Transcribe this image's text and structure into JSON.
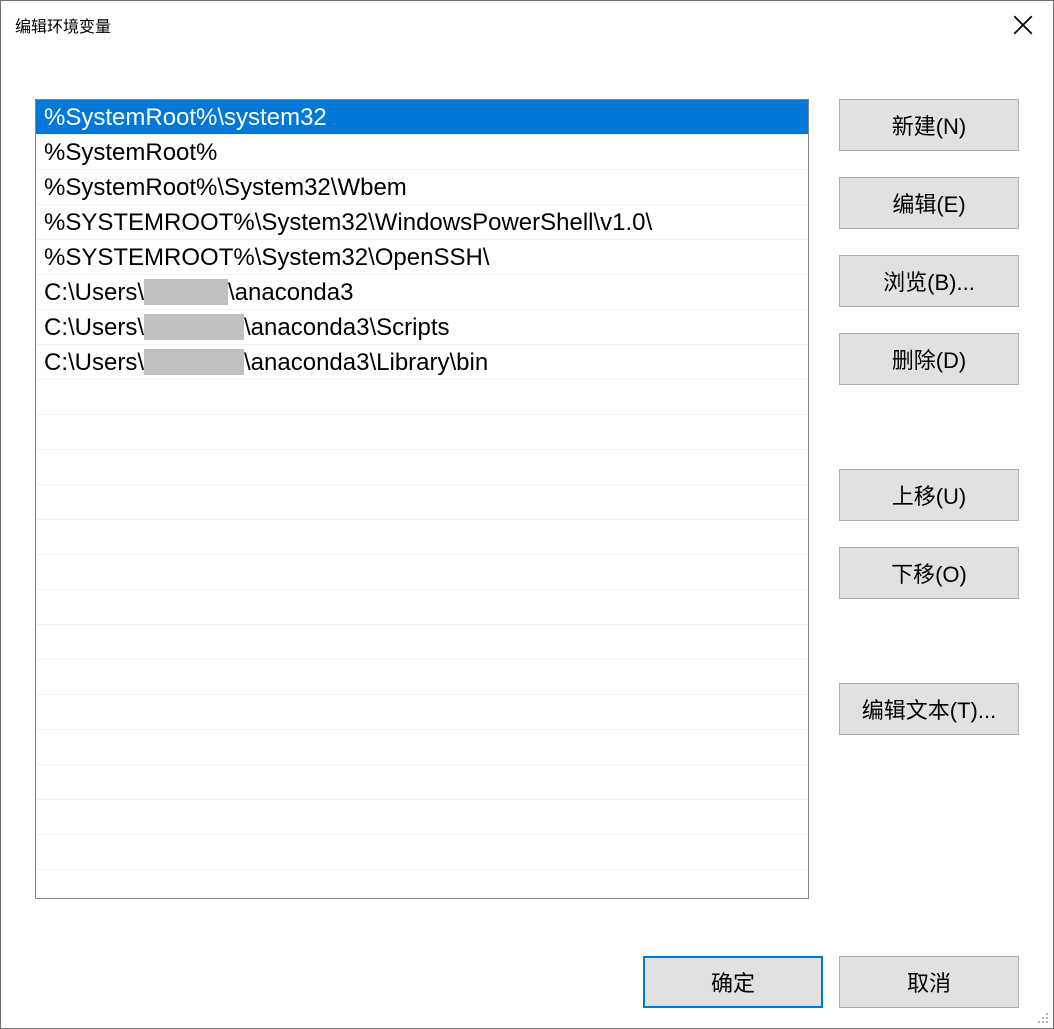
{
  "title": "编辑环境变量",
  "redacted_label": "[redacted]",
  "entries": [
    {
      "prefix": "%SystemRoot%\\system32",
      "redacted_width": 0,
      "suffix": "",
      "selected": true
    },
    {
      "prefix": "%SystemRoot%",
      "redacted_width": 0,
      "suffix": "",
      "selected": false
    },
    {
      "prefix": "%SystemRoot%\\System32\\Wbem",
      "redacted_width": 0,
      "suffix": "",
      "selected": false
    },
    {
      "prefix": "%SYSTEMROOT%\\System32\\WindowsPowerShell\\v1.0\\",
      "redacted_width": 0,
      "suffix": "",
      "selected": false
    },
    {
      "prefix": "%SYSTEMROOT%\\System32\\OpenSSH\\",
      "redacted_width": 0,
      "suffix": "",
      "selected": false
    },
    {
      "prefix": "C:\\Users\\",
      "redacted_width": 84,
      "suffix": "\\anaconda3",
      "selected": false
    },
    {
      "prefix": "C:\\Users\\",
      "redacted_width": 100,
      "suffix": "\\anaconda3\\Scripts",
      "selected": false
    },
    {
      "prefix": "C:\\Users\\",
      "redacted_width": 100,
      "suffix": "\\anaconda3\\Library\\bin",
      "selected": false
    }
  ],
  "buttons": {
    "new": "新建(N)",
    "edit": "编辑(E)",
    "browse": "浏览(B)...",
    "delete": "删除(D)",
    "move_up": "上移(U)",
    "move_down": "下移(O)",
    "edit_text": "编辑文本(T)...",
    "ok": "确定",
    "cancel": "取消"
  }
}
